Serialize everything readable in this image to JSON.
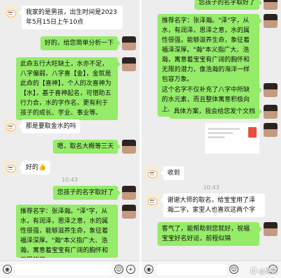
{
  "left": {
    "messages": [
      {
        "from": "me",
        "text": "我家的是男孩，出生时间是2023年5月15日上午10点"
      },
      {
        "from": "master",
        "text": "好的，给您简单分析一下"
      },
      {
        "from": "master",
        "text": "此命五行大旺缺土，水亦不足，八字偏弱，八字喜【金】，金就是此命的【喜神】，个人的次喜神为【水】，基于喜神起名，可借助五行力合，水的字作名，更有利于孩子的成长、学业、事业等。"
      },
      {
        "from": "me",
        "text": "那是要取金水的吗"
      },
      {
        "from": "master",
        "text": "嗯，取名大概等三天"
      },
      {
        "from": "me",
        "text": "好的👍"
      },
      {
        "from": "master",
        "text": "您孩子的名字取好了"
      },
      {
        "from": "master",
        "text": "推荐名字：张泽瀚。\"泽\"字，从水，有润泽，恩泽之意，水的属性很强，能够滋养生命，象征着福泽深厚。\"瀚\"本义指广大、浩瀚，寓意着宝宝有广阔的胸怀和无限的潜"
      }
    ],
    "time": "10:43",
    "input": {
      "voice": "◉",
      "emoji": "☺",
      "plus": "+"
    }
  },
  "right": {
    "messages": [
      {
        "from": "master",
        "text": "您孩子的名字取好了"
      },
      {
        "from": "master",
        "text": "推荐名字：张泽瀚。\"泽\"字，从水，有润泽，恩泽之意，水的属性很强，能够滋养生命，象征着福泽深厚。\"瀚\"本义指广大、浩瀚，寓意着宝宝有广阔的胸怀和无限的潜力，像浩瀚的海洋一样包容万象。"
      },
      {
        "from": "master",
        "text": "这个名字不仅补充了八字中所缺的水元素，而且整体寓意积极向上。"
      },
      {
        "from": "master",
        "text": "具体方案，我会给您发个文档"
      },
      {
        "from": "me",
        "text": "收到"
      },
      {
        "from": "me",
        "text": "谢谢大师的取名，给宝宝用了泽瀚二字，家里人也喜欢这两个字"
      },
      {
        "from": "master",
        "text": "客气了，能帮助到您就好，祝福宝宝好名好运，前程似锦"
      }
    ],
    "time": "10:43",
    "input": {
      "voice": "◉",
      "emoji": "☺",
      "plus": "+"
    },
    "watermark": "🅞 @连营"
  }
}
